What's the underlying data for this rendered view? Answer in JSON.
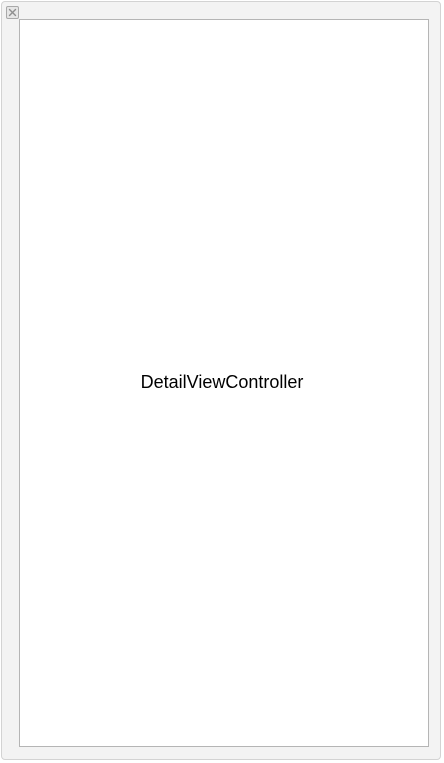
{
  "scene": {
    "controller_label": "DetailViewController",
    "close_icon": "close-icon",
    "colors": {
      "frame_background": "#f3f3f3",
      "view_background": "#ffffff",
      "view_border": "#b5b5b5",
      "label_text": "#000000"
    }
  }
}
